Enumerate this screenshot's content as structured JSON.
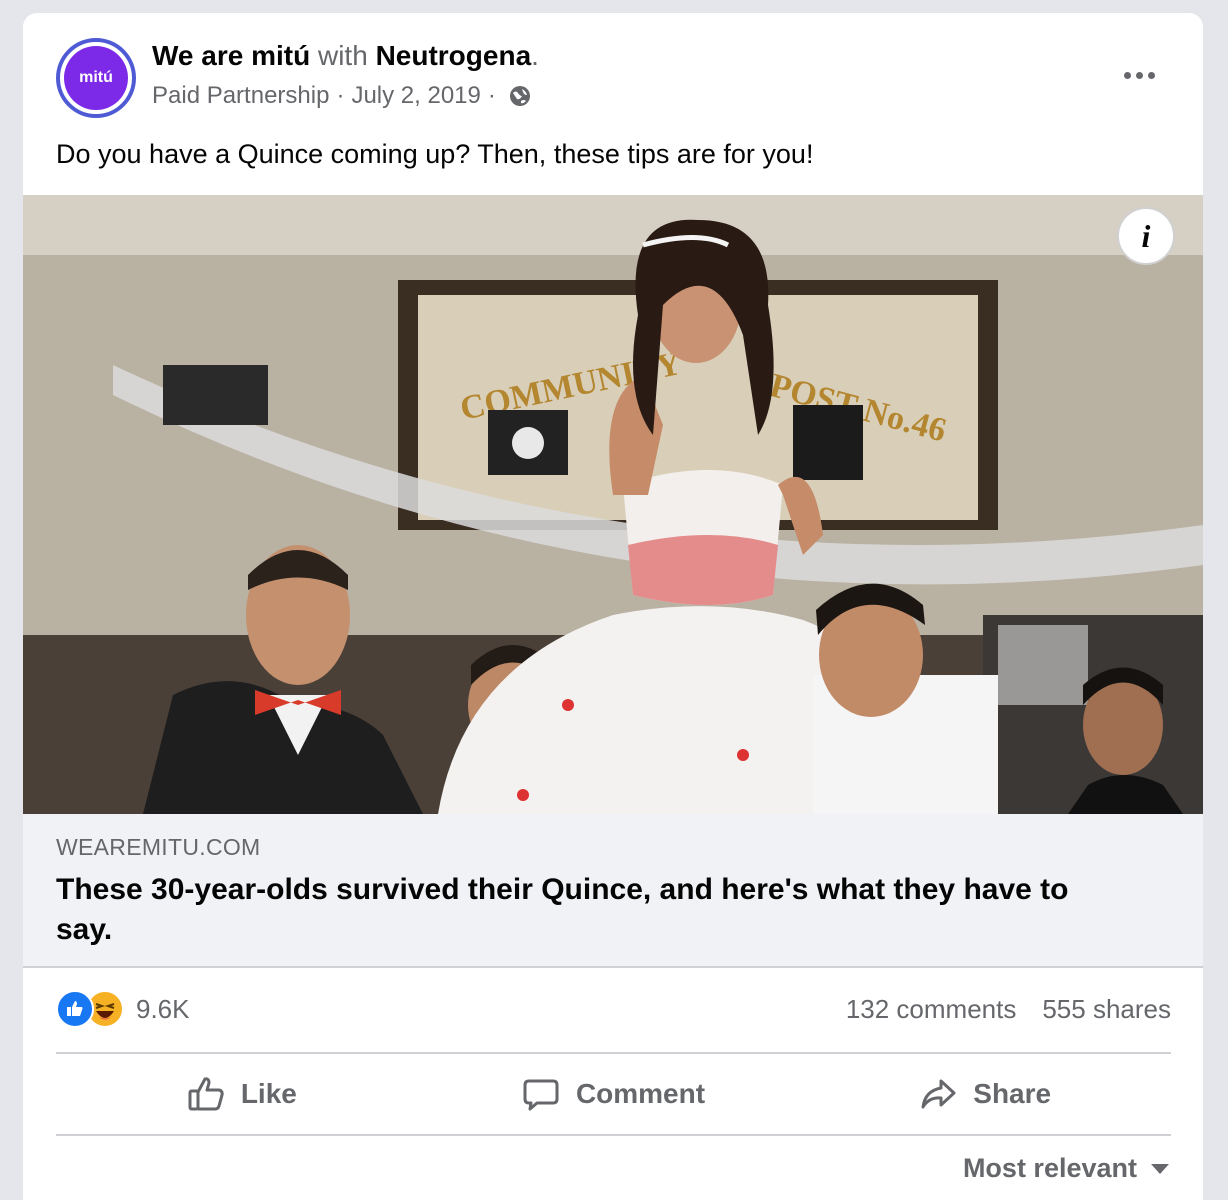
{
  "post": {
    "author": "We are mitú",
    "with_word": "with",
    "partner": "Neutrogena",
    "period": ".",
    "avatar_text": "mitú",
    "meta_label": "Paid Partnership",
    "dot1": "·",
    "date": "July 2, 2019",
    "dot2": "·",
    "audience_icon": "globe-icon",
    "text": "Do you have a Quince coming up? Then, these tips are for you!",
    "info_symbol": "i"
  },
  "link": {
    "domain": "WEAREMITU.COM",
    "title": "These 30-year-olds survived their Quince, and here's what they have to say."
  },
  "photo": {
    "sign_text": "COMMUNITY",
    "sign_text_2": "POST No.46"
  },
  "stats": {
    "reaction_count": "9.6K",
    "comments": "132 comments",
    "shares": "555 shares"
  },
  "actions": {
    "like": "Like",
    "comment": "Comment",
    "share": "Share"
  },
  "sort": {
    "label": "Most relevant"
  },
  "colors": {
    "accent": "#1877f2",
    "brand": "#7c2ae8",
    "muted": "#65676b"
  }
}
